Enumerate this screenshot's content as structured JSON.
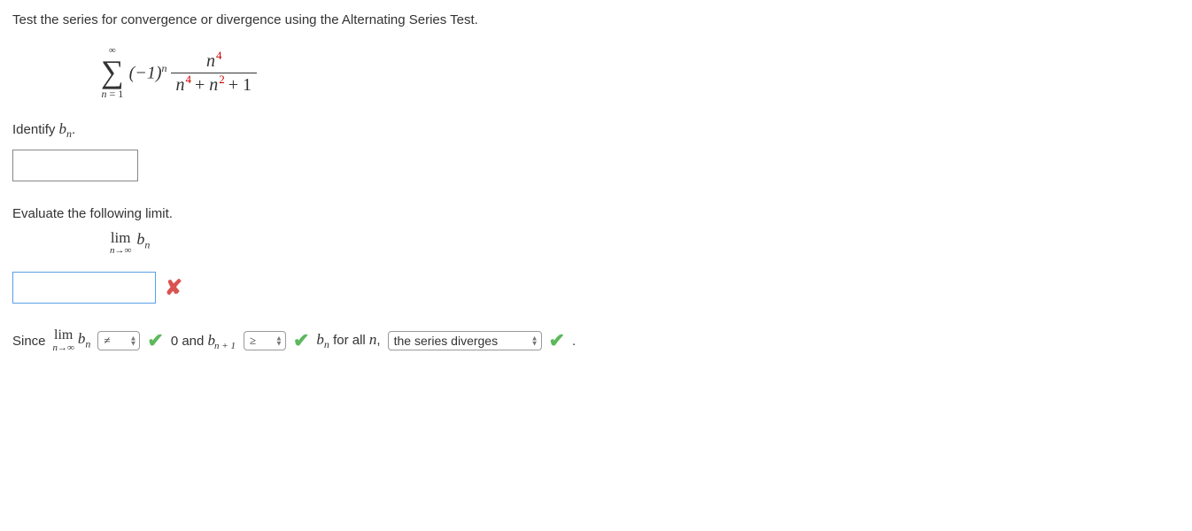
{
  "title": "Test the series for convergence or divergence using the Alternating Series Test.",
  "series": {
    "upper": "∞",
    "lower_var": "n",
    "lower_eq": "= 1",
    "coef_base": "(−1)",
    "coef_exp": "n",
    "num_var": "n",
    "num_exp": "4",
    "denom_t1_var": "n",
    "denom_t1_exp": "4",
    "denom_plus1": " + ",
    "denom_t2_var": "n",
    "denom_t2_exp": "2",
    "denom_plus2": " + 1"
  },
  "step1": {
    "label_prefix": "Identify ",
    "var": "b",
    "sub": "n",
    "label_suffix": "."
  },
  "input1_value": "",
  "step2": {
    "label": "Evaluate the following limit.",
    "lim": "lim",
    "approach": "n→∞",
    "var": "b",
    "sub": "n"
  },
  "input2_value": "",
  "final": {
    "since": "Since",
    "lim": "lim",
    "approach": "n→∞",
    "bvar": "b",
    "bsub": "n",
    "dd1": "≠",
    "zero_and": "0 and ",
    "b2var": "b",
    "b2sub": "n + 1",
    "dd2": "≥",
    "b3var": "b",
    "b3sub": "n",
    "forall": " for all ",
    "nvar": "n",
    "comma": ", ",
    "dd3": "the series diverges",
    "period": "."
  }
}
